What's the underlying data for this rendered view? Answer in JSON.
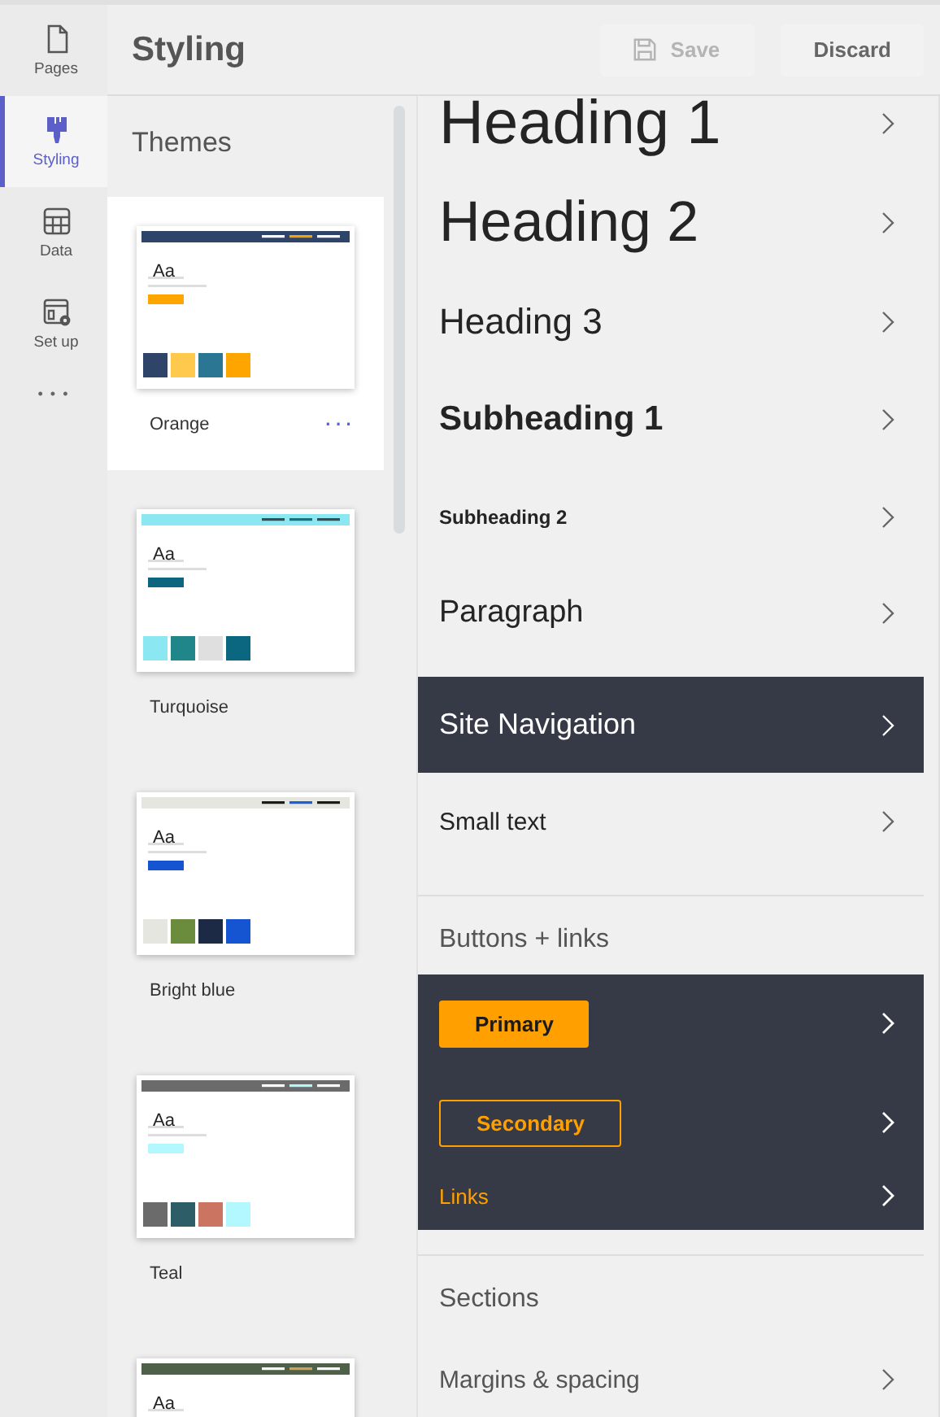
{
  "rail": [
    {
      "label": "Pages",
      "selected": false
    },
    {
      "label": "Styling",
      "selected": true
    },
    {
      "label": "Data",
      "selected": false
    },
    {
      "label": "Set up",
      "selected": false
    }
  ],
  "rail_more": "• • •",
  "header": {
    "title": "Styling",
    "buttons": [
      {
        "label": "Save",
        "kind": "save",
        "disabled": true
      },
      {
        "label": "Discard",
        "kind": "discard",
        "disabled": false
      }
    ]
  },
  "themes": {
    "title": "Themes",
    "more": "···",
    "items": [
      {
        "name": "Orange",
        "sample": "Aa",
        "selected": true
      },
      {
        "name": "Turquoise",
        "sample": "Aa",
        "selected": false
      },
      {
        "name": "Bright blue",
        "sample": "Aa",
        "selected": false
      },
      {
        "name": "Teal",
        "sample": "Aa",
        "selected": false
      },
      {
        "sample": "Aa",
        "selected": false
      }
    ]
  },
  "styles": [
    {
      "label": "Heading 1",
      "kind": "h1"
    },
    {
      "label": "Heading 2",
      "kind": "h2"
    },
    {
      "label": "Heading 3",
      "kind": "h3"
    },
    {
      "label": "Subheading 1",
      "kind": "sub1"
    },
    {
      "label": "Subheading 2",
      "kind": "sub2"
    },
    {
      "label": "Paragraph",
      "kind": "paragraph"
    },
    {
      "label": "Site Navigation",
      "kind": "nav"
    },
    {
      "label": "Small text",
      "kind": "small"
    }
  ],
  "buttons_links": {
    "title": "Buttons + links",
    "items": [
      {
        "label": "Primary",
        "kind": "primary"
      },
      {
        "label": "Secondary",
        "kind": "secondary"
      },
      {
        "label": "Links",
        "kind": "link"
      }
    ]
  },
  "sections": {
    "title": "Sections",
    "items": [
      {
        "label": "Margins & spacing"
      }
    ]
  }
}
